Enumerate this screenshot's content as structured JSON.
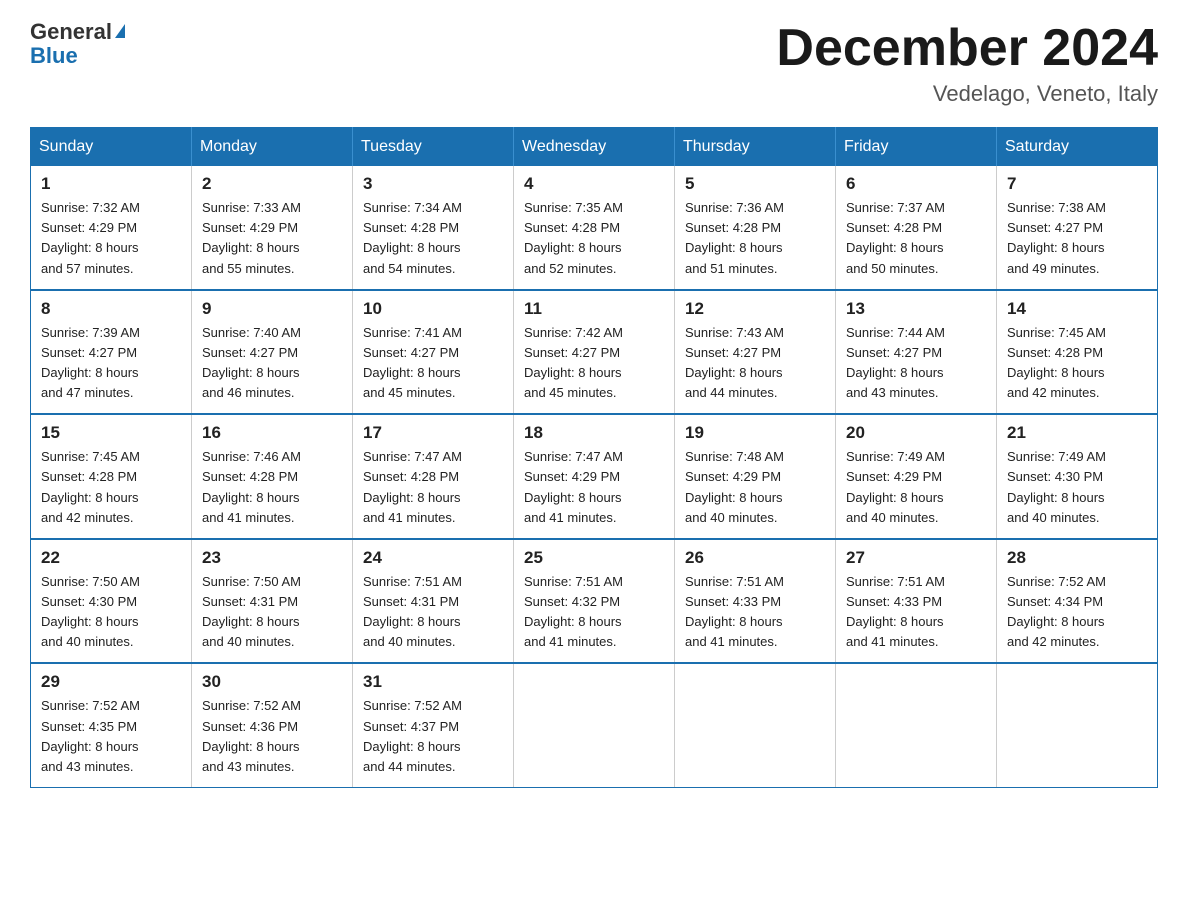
{
  "header": {
    "logo_general": "General",
    "logo_blue": "Blue",
    "title": "December 2024",
    "subtitle": "Vedelago, Veneto, Italy"
  },
  "days_of_week": [
    "Sunday",
    "Monday",
    "Tuesday",
    "Wednesday",
    "Thursday",
    "Friday",
    "Saturday"
  ],
  "weeks": [
    [
      {
        "day": "1",
        "sunrise": "7:32 AM",
        "sunset": "4:29 PM",
        "daylight": "8 hours and 57 minutes."
      },
      {
        "day": "2",
        "sunrise": "7:33 AM",
        "sunset": "4:29 PM",
        "daylight": "8 hours and 55 minutes."
      },
      {
        "day": "3",
        "sunrise": "7:34 AM",
        "sunset": "4:28 PM",
        "daylight": "8 hours and 54 minutes."
      },
      {
        "day": "4",
        "sunrise": "7:35 AM",
        "sunset": "4:28 PM",
        "daylight": "8 hours and 52 minutes."
      },
      {
        "day": "5",
        "sunrise": "7:36 AM",
        "sunset": "4:28 PM",
        "daylight": "8 hours and 51 minutes."
      },
      {
        "day": "6",
        "sunrise": "7:37 AM",
        "sunset": "4:28 PM",
        "daylight": "8 hours and 50 minutes."
      },
      {
        "day": "7",
        "sunrise": "7:38 AM",
        "sunset": "4:27 PM",
        "daylight": "8 hours and 49 minutes."
      }
    ],
    [
      {
        "day": "8",
        "sunrise": "7:39 AM",
        "sunset": "4:27 PM",
        "daylight": "8 hours and 47 minutes."
      },
      {
        "day": "9",
        "sunrise": "7:40 AM",
        "sunset": "4:27 PM",
        "daylight": "8 hours and 46 minutes."
      },
      {
        "day": "10",
        "sunrise": "7:41 AM",
        "sunset": "4:27 PM",
        "daylight": "8 hours and 45 minutes."
      },
      {
        "day": "11",
        "sunrise": "7:42 AM",
        "sunset": "4:27 PM",
        "daylight": "8 hours and 45 minutes."
      },
      {
        "day": "12",
        "sunrise": "7:43 AM",
        "sunset": "4:27 PM",
        "daylight": "8 hours and 44 minutes."
      },
      {
        "day": "13",
        "sunrise": "7:44 AM",
        "sunset": "4:27 PM",
        "daylight": "8 hours and 43 minutes."
      },
      {
        "day": "14",
        "sunrise": "7:45 AM",
        "sunset": "4:28 PM",
        "daylight": "8 hours and 42 minutes."
      }
    ],
    [
      {
        "day": "15",
        "sunrise": "7:45 AM",
        "sunset": "4:28 PM",
        "daylight": "8 hours and 42 minutes."
      },
      {
        "day": "16",
        "sunrise": "7:46 AM",
        "sunset": "4:28 PM",
        "daylight": "8 hours and 41 minutes."
      },
      {
        "day": "17",
        "sunrise": "7:47 AM",
        "sunset": "4:28 PM",
        "daylight": "8 hours and 41 minutes."
      },
      {
        "day": "18",
        "sunrise": "7:47 AM",
        "sunset": "4:29 PM",
        "daylight": "8 hours and 41 minutes."
      },
      {
        "day": "19",
        "sunrise": "7:48 AM",
        "sunset": "4:29 PM",
        "daylight": "8 hours and 40 minutes."
      },
      {
        "day": "20",
        "sunrise": "7:49 AM",
        "sunset": "4:29 PM",
        "daylight": "8 hours and 40 minutes."
      },
      {
        "day": "21",
        "sunrise": "7:49 AM",
        "sunset": "4:30 PM",
        "daylight": "8 hours and 40 minutes."
      }
    ],
    [
      {
        "day": "22",
        "sunrise": "7:50 AM",
        "sunset": "4:30 PM",
        "daylight": "8 hours and 40 minutes."
      },
      {
        "day": "23",
        "sunrise": "7:50 AM",
        "sunset": "4:31 PM",
        "daylight": "8 hours and 40 minutes."
      },
      {
        "day": "24",
        "sunrise": "7:51 AM",
        "sunset": "4:31 PM",
        "daylight": "8 hours and 40 minutes."
      },
      {
        "day": "25",
        "sunrise": "7:51 AM",
        "sunset": "4:32 PM",
        "daylight": "8 hours and 41 minutes."
      },
      {
        "day": "26",
        "sunrise": "7:51 AM",
        "sunset": "4:33 PM",
        "daylight": "8 hours and 41 minutes."
      },
      {
        "day": "27",
        "sunrise": "7:51 AM",
        "sunset": "4:33 PM",
        "daylight": "8 hours and 41 minutes."
      },
      {
        "day": "28",
        "sunrise": "7:52 AM",
        "sunset": "4:34 PM",
        "daylight": "8 hours and 42 minutes."
      }
    ],
    [
      {
        "day": "29",
        "sunrise": "7:52 AM",
        "sunset": "4:35 PM",
        "daylight": "8 hours and 43 minutes."
      },
      {
        "day": "30",
        "sunrise": "7:52 AM",
        "sunset": "4:36 PM",
        "daylight": "8 hours and 43 minutes."
      },
      {
        "day": "31",
        "sunrise": "7:52 AM",
        "sunset": "4:37 PM",
        "daylight": "8 hours and 44 minutes."
      },
      null,
      null,
      null,
      null
    ]
  ]
}
